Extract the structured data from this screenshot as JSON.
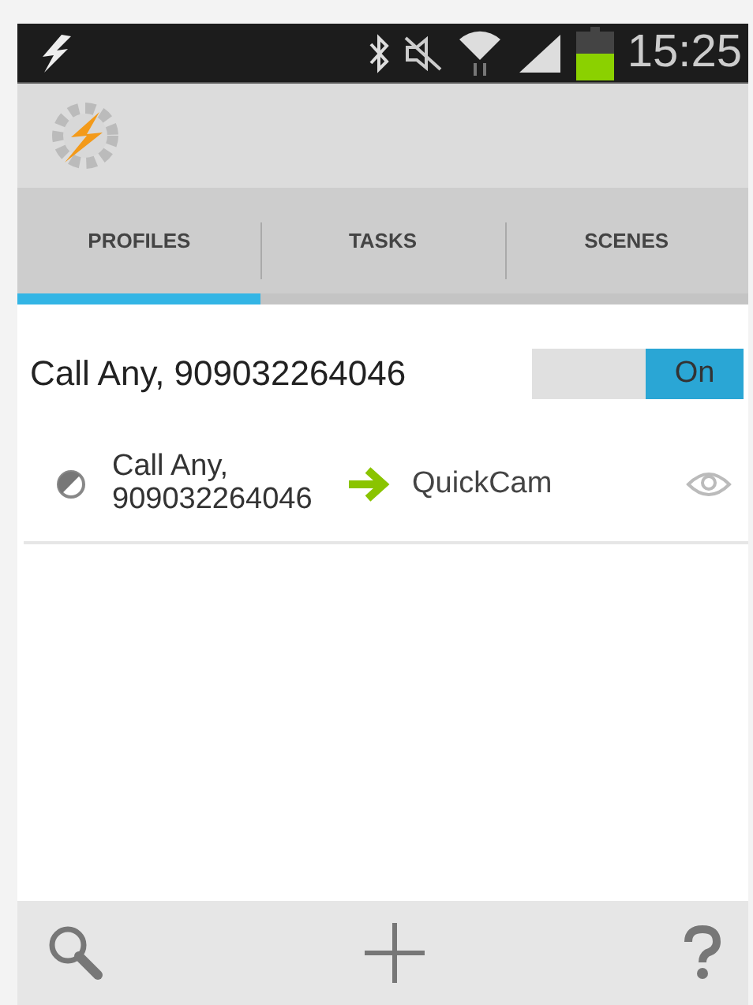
{
  "status_bar": {
    "time": "15:25"
  },
  "tabs": [
    {
      "label": "PROFILES",
      "selected": true
    },
    {
      "label": "TASKS",
      "selected": false
    },
    {
      "label": "SCENES",
      "selected": false
    }
  ],
  "profile": {
    "name": "Call Any, 909032264046",
    "toggle": {
      "label": "On",
      "on": true
    },
    "context": "Call Any, 909032264046",
    "task": "QuickCam"
  }
}
